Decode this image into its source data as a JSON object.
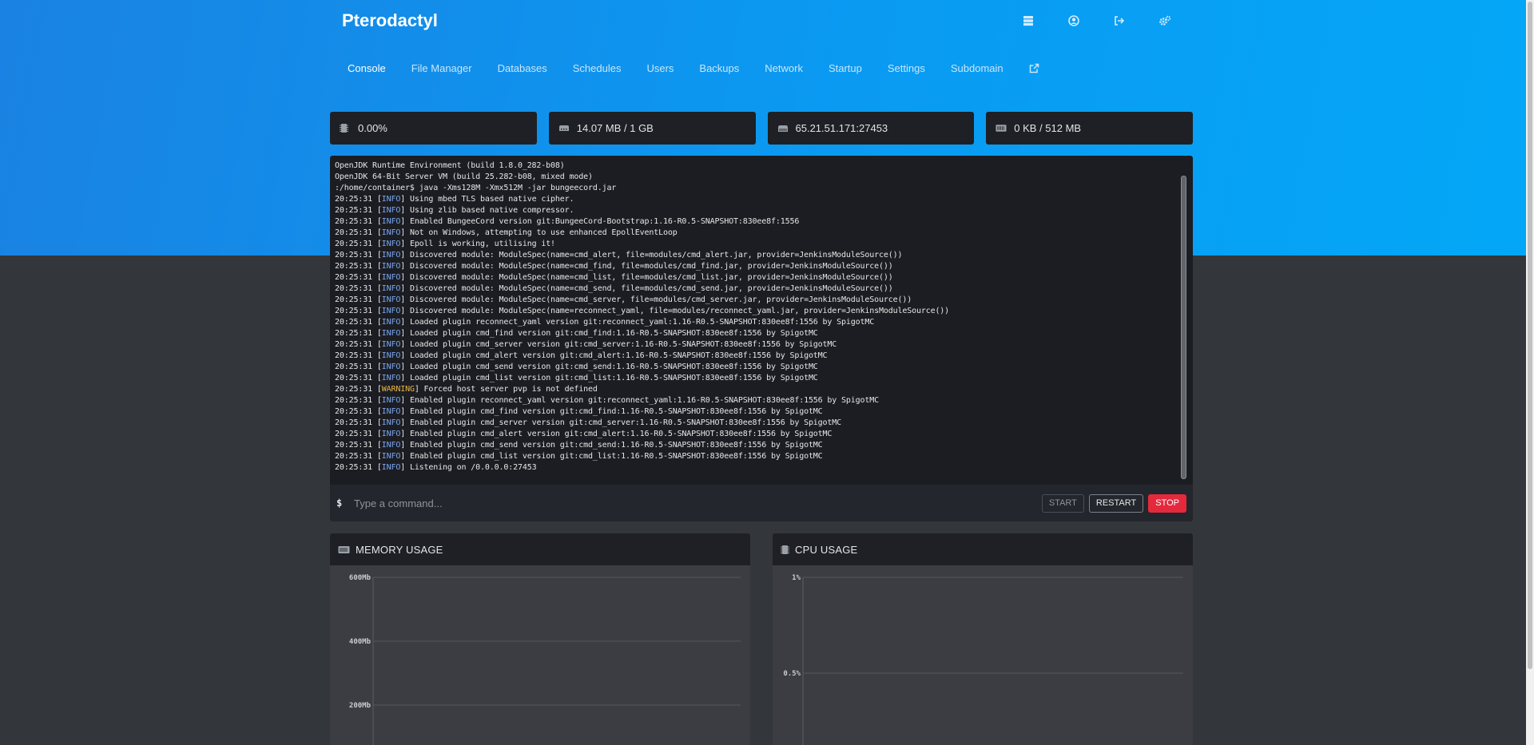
{
  "app": {
    "brand": "Pterodactyl"
  },
  "topbar": {
    "icons": [
      "server-list-icon",
      "account-icon",
      "logout-icon",
      "admin-cogs-icon"
    ]
  },
  "nav": {
    "items": [
      {
        "label": "Console",
        "active": true
      },
      {
        "label": "File Manager"
      },
      {
        "label": "Databases"
      },
      {
        "label": "Schedules"
      },
      {
        "label": "Users"
      },
      {
        "label": "Backups"
      },
      {
        "label": "Network"
      },
      {
        "label": "Startup"
      },
      {
        "label": "Settings"
      },
      {
        "label": "Subdomain"
      }
    ],
    "external_icon": "external-link-icon"
  },
  "stats": {
    "cpu": {
      "icon": "microchip-icon",
      "value": "0.00%"
    },
    "memory": {
      "icon": "memory-icon",
      "value": "14.07 MB / 1 GB"
    },
    "address": {
      "icon": "network-icon",
      "value": "65.21.51.171:27453"
    },
    "disk": {
      "icon": "hdd-icon",
      "value": "0 KB / 512 MB"
    }
  },
  "console": {
    "lines": [
      {
        "text": "OpenJDK Runtime Environment (build 1.8.0_282-b08)"
      },
      {
        "text": "OpenJDK 64-Bit Server VM (build 25.282-b08, mixed mode)"
      },
      {
        "text": ":/home/container$ java -Xms128M -Xmx512M -jar bungeecord.jar"
      },
      {
        "time": "20:25:31",
        "level": "INFO",
        "msg": "Using mbed TLS based native cipher."
      },
      {
        "time": "20:25:31",
        "level": "INFO",
        "msg": "Using zlib based native compressor."
      },
      {
        "time": "20:25:31",
        "level": "INFO",
        "msg": "Enabled BungeeCord version git:BungeeCord-Bootstrap:1.16-R0.5-SNAPSHOT:830ee8f:1556"
      },
      {
        "time": "20:25:31",
        "level": "INFO",
        "msg": "Not on Windows, attempting to use enhanced EpollEventLoop"
      },
      {
        "time": "20:25:31",
        "level": "INFO",
        "msg": "Epoll is working, utilising it!"
      },
      {
        "time": "20:25:31",
        "level": "INFO",
        "msg": "Discovered module: ModuleSpec(name=cmd_alert, file=modules/cmd_alert.jar, provider=JenkinsModuleSource())"
      },
      {
        "time": "20:25:31",
        "level": "INFO",
        "msg": "Discovered module: ModuleSpec(name=cmd_find, file=modules/cmd_find.jar, provider=JenkinsModuleSource())"
      },
      {
        "time": "20:25:31",
        "level": "INFO",
        "msg": "Discovered module: ModuleSpec(name=cmd_list, file=modules/cmd_list.jar, provider=JenkinsModuleSource())"
      },
      {
        "time": "20:25:31",
        "level": "INFO",
        "msg": "Discovered module: ModuleSpec(name=cmd_send, file=modules/cmd_send.jar, provider=JenkinsModuleSource())"
      },
      {
        "time": "20:25:31",
        "level": "INFO",
        "msg": "Discovered module: ModuleSpec(name=cmd_server, file=modules/cmd_server.jar, provider=JenkinsModuleSource())"
      },
      {
        "time": "20:25:31",
        "level": "INFO",
        "msg": "Discovered module: ModuleSpec(name=reconnect_yaml, file=modules/reconnect_yaml.jar, provider=JenkinsModuleSource())"
      },
      {
        "time": "20:25:31",
        "level": "INFO",
        "msg": "Loaded plugin reconnect_yaml version git:reconnect_yaml:1.16-R0.5-SNAPSHOT:830ee8f:1556 by SpigotMC"
      },
      {
        "time": "20:25:31",
        "level": "INFO",
        "msg": "Loaded plugin cmd_find version git:cmd_find:1.16-R0.5-SNAPSHOT:830ee8f:1556 by SpigotMC"
      },
      {
        "time": "20:25:31",
        "level": "INFO",
        "msg": "Loaded plugin cmd_server version git:cmd_server:1.16-R0.5-SNAPSHOT:830ee8f:1556 by SpigotMC"
      },
      {
        "time": "20:25:31",
        "level": "INFO",
        "msg": "Loaded plugin cmd_alert version git:cmd_alert:1.16-R0.5-SNAPSHOT:830ee8f:1556 by SpigotMC"
      },
      {
        "time": "20:25:31",
        "level": "INFO",
        "msg": "Loaded plugin cmd_send version git:cmd_send:1.16-R0.5-SNAPSHOT:830ee8f:1556 by SpigotMC"
      },
      {
        "time": "20:25:31",
        "level": "INFO",
        "msg": "Loaded plugin cmd_list version git:cmd_list:1.16-R0.5-SNAPSHOT:830ee8f:1556 by SpigotMC"
      },
      {
        "time": "20:25:31",
        "level": "WARNING",
        "msg": "Forced host server pvp is not defined"
      },
      {
        "time": "20:25:31",
        "level": "INFO",
        "msg": "Enabled plugin reconnect_yaml version git:reconnect_yaml:1.16-R0.5-SNAPSHOT:830ee8f:1556 by SpigotMC"
      },
      {
        "time": "20:25:31",
        "level": "INFO",
        "msg": "Enabled plugin cmd_find version git:cmd_find:1.16-R0.5-SNAPSHOT:830ee8f:1556 by SpigotMC"
      },
      {
        "time": "20:25:31",
        "level": "INFO",
        "msg": "Enabled plugin cmd_server version git:cmd_server:1.16-R0.5-SNAPSHOT:830ee8f:1556 by SpigotMC"
      },
      {
        "time": "20:25:31",
        "level": "INFO",
        "msg": "Enabled plugin cmd_alert version git:cmd_alert:1.16-R0.5-SNAPSHOT:830ee8f:1556 by SpigotMC"
      },
      {
        "time": "20:25:31",
        "level": "INFO",
        "msg": "Enabled plugin cmd_send version git:cmd_send:1.16-R0.5-SNAPSHOT:830ee8f:1556 by SpigotMC"
      },
      {
        "time": "20:25:31",
        "level": "INFO",
        "msg": "Enabled plugin cmd_list version git:cmd_list:1.16-R0.5-SNAPSHOT:830ee8f:1556 by SpigotMC"
      },
      {
        "time": "20:25:31",
        "level": "INFO",
        "msg": "Listening on /0.0.0.0:27453"
      }
    ],
    "prompt": "$",
    "placeholder": "Type a command...",
    "buttons": {
      "start": "START",
      "restart": "RESTART",
      "stop": "STOP"
    }
  },
  "charts": {
    "memory": {
      "title": "MEMORY USAGE",
      "icon": "memory-icon"
    },
    "cpu": {
      "title": "CPU USAGE",
      "icon": "microchip-icon"
    }
  },
  "chart_data": [
    {
      "type": "line",
      "title": "MEMORY USAGE",
      "y_tick_labels": [
        "600Mb",
        "400Mb",
        "200Mb"
      ],
      "y_ticks": [
        600,
        400,
        200
      ],
      "grid": true
    },
    {
      "type": "line",
      "title": "CPU USAGE",
      "y_tick_labels": [
        "1%",
        "0.5%"
      ],
      "y_ticks": [
        1,
        0.5
      ],
      "grid": true
    }
  ],
  "colors": {
    "accent": "#0a9af2",
    "stop": "#e5293d",
    "info_tag": "#7aa6ef",
    "warning_tag": "#e8b54a"
  }
}
